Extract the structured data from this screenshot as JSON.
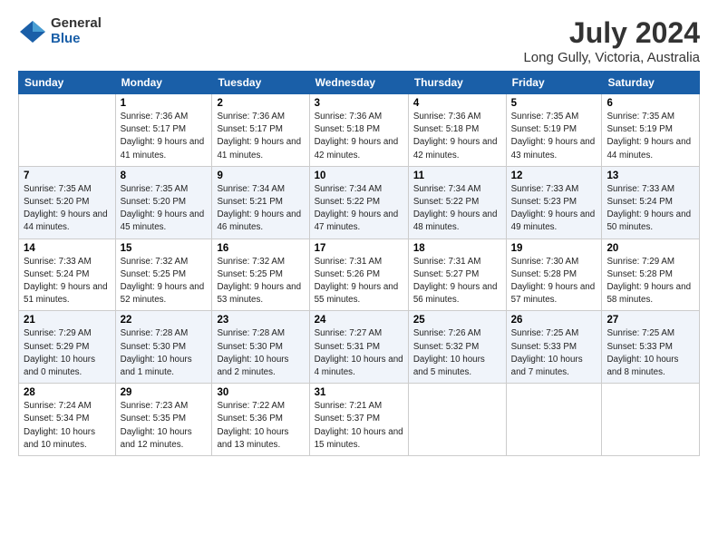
{
  "logo": {
    "general": "General",
    "blue": "Blue"
  },
  "header": {
    "title": "July 2024",
    "subtitle": "Long Gully, Victoria, Australia"
  },
  "weekdays": [
    "Sunday",
    "Monday",
    "Tuesday",
    "Wednesday",
    "Thursday",
    "Friday",
    "Saturday"
  ],
  "weeks": [
    [
      {
        "day": "",
        "sunrise": "",
        "sunset": "",
        "daylight": ""
      },
      {
        "day": "1",
        "sunrise": "Sunrise: 7:36 AM",
        "sunset": "Sunset: 5:17 PM",
        "daylight": "Daylight: 9 hours and 41 minutes."
      },
      {
        "day": "2",
        "sunrise": "Sunrise: 7:36 AM",
        "sunset": "Sunset: 5:17 PM",
        "daylight": "Daylight: 9 hours and 41 minutes."
      },
      {
        "day": "3",
        "sunrise": "Sunrise: 7:36 AM",
        "sunset": "Sunset: 5:18 PM",
        "daylight": "Daylight: 9 hours and 42 minutes."
      },
      {
        "day": "4",
        "sunrise": "Sunrise: 7:36 AM",
        "sunset": "Sunset: 5:18 PM",
        "daylight": "Daylight: 9 hours and 42 minutes."
      },
      {
        "day": "5",
        "sunrise": "Sunrise: 7:35 AM",
        "sunset": "Sunset: 5:19 PM",
        "daylight": "Daylight: 9 hours and 43 minutes."
      },
      {
        "day": "6",
        "sunrise": "Sunrise: 7:35 AM",
        "sunset": "Sunset: 5:19 PM",
        "daylight": "Daylight: 9 hours and 44 minutes."
      }
    ],
    [
      {
        "day": "7",
        "sunrise": "Sunrise: 7:35 AM",
        "sunset": "Sunset: 5:20 PM",
        "daylight": "Daylight: 9 hours and 44 minutes."
      },
      {
        "day": "8",
        "sunrise": "Sunrise: 7:35 AM",
        "sunset": "Sunset: 5:20 PM",
        "daylight": "Daylight: 9 hours and 45 minutes."
      },
      {
        "day": "9",
        "sunrise": "Sunrise: 7:34 AM",
        "sunset": "Sunset: 5:21 PM",
        "daylight": "Daylight: 9 hours and 46 minutes."
      },
      {
        "day": "10",
        "sunrise": "Sunrise: 7:34 AM",
        "sunset": "Sunset: 5:22 PM",
        "daylight": "Daylight: 9 hours and 47 minutes."
      },
      {
        "day": "11",
        "sunrise": "Sunrise: 7:34 AM",
        "sunset": "Sunset: 5:22 PM",
        "daylight": "Daylight: 9 hours and 48 minutes."
      },
      {
        "day": "12",
        "sunrise": "Sunrise: 7:33 AM",
        "sunset": "Sunset: 5:23 PM",
        "daylight": "Daylight: 9 hours and 49 minutes."
      },
      {
        "day": "13",
        "sunrise": "Sunrise: 7:33 AM",
        "sunset": "Sunset: 5:24 PM",
        "daylight": "Daylight: 9 hours and 50 minutes."
      }
    ],
    [
      {
        "day": "14",
        "sunrise": "Sunrise: 7:33 AM",
        "sunset": "Sunset: 5:24 PM",
        "daylight": "Daylight: 9 hours and 51 minutes."
      },
      {
        "day": "15",
        "sunrise": "Sunrise: 7:32 AM",
        "sunset": "Sunset: 5:25 PM",
        "daylight": "Daylight: 9 hours and 52 minutes."
      },
      {
        "day": "16",
        "sunrise": "Sunrise: 7:32 AM",
        "sunset": "Sunset: 5:25 PM",
        "daylight": "Daylight: 9 hours and 53 minutes."
      },
      {
        "day": "17",
        "sunrise": "Sunrise: 7:31 AM",
        "sunset": "Sunset: 5:26 PM",
        "daylight": "Daylight: 9 hours and 55 minutes."
      },
      {
        "day": "18",
        "sunrise": "Sunrise: 7:31 AM",
        "sunset": "Sunset: 5:27 PM",
        "daylight": "Daylight: 9 hours and 56 minutes."
      },
      {
        "day": "19",
        "sunrise": "Sunrise: 7:30 AM",
        "sunset": "Sunset: 5:28 PM",
        "daylight": "Daylight: 9 hours and 57 minutes."
      },
      {
        "day": "20",
        "sunrise": "Sunrise: 7:29 AM",
        "sunset": "Sunset: 5:28 PM",
        "daylight": "Daylight: 9 hours and 58 minutes."
      }
    ],
    [
      {
        "day": "21",
        "sunrise": "Sunrise: 7:29 AM",
        "sunset": "Sunset: 5:29 PM",
        "daylight": "Daylight: 10 hours and 0 minutes."
      },
      {
        "day": "22",
        "sunrise": "Sunrise: 7:28 AM",
        "sunset": "Sunset: 5:30 PM",
        "daylight": "Daylight: 10 hours and 1 minute."
      },
      {
        "day": "23",
        "sunrise": "Sunrise: 7:28 AM",
        "sunset": "Sunset: 5:30 PM",
        "daylight": "Daylight: 10 hours and 2 minutes."
      },
      {
        "day": "24",
        "sunrise": "Sunrise: 7:27 AM",
        "sunset": "Sunset: 5:31 PM",
        "daylight": "Daylight: 10 hours and 4 minutes."
      },
      {
        "day": "25",
        "sunrise": "Sunrise: 7:26 AM",
        "sunset": "Sunset: 5:32 PM",
        "daylight": "Daylight: 10 hours and 5 minutes."
      },
      {
        "day": "26",
        "sunrise": "Sunrise: 7:25 AM",
        "sunset": "Sunset: 5:33 PM",
        "daylight": "Daylight: 10 hours and 7 minutes."
      },
      {
        "day": "27",
        "sunrise": "Sunrise: 7:25 AM",
        "sunset": "Sunset: 5:33 PM",
        "daylight": "Daylight: 10 hours and 8 minutes."
      }
    ],
    [
      {
        "day": "28",
        "sunrise": "Sunrise: 7:24 AM",
        "sunset": "Sunset: 5:34 PM",
        "daylight": "Daylight: 10 hours and 10 minutes."
      },
      {
        "day": "29",
        "sunrise": "Sunrise: 7:23 AM",
        "sunset": "Sunset: 5:35 PM",
        "daylight": "Daylight: 10 hours and 12 minutes."
      },
      {
        "day": "30",
        "sunrise": "Sunrise: 7:22 AM",
        "sunset": "Sunset: 5:36 PM",
        "daylight": "Daylight: 10 hours and 13 minutes."
      },
      {
        "day": "31",
        "sunrise": "Sunrise: 7:21 AM",
        "sunset": "Sunset: 5:37 PM",
        "daylight": "Daylight: 10 hours and 15 minutes."
      },
      {
        "day": "",
        "sunrise": "",
        "sunset": "",
        "daylight": ""
      },
      {
        "day": "",
        "sunrise": "",
        "sunset": "",
        "daylight": ""
      },
      {
        "day": "",
        "sunrise": "",
        "sunset": "",
        "daylight": ""
      }
    ]
  ]
}
